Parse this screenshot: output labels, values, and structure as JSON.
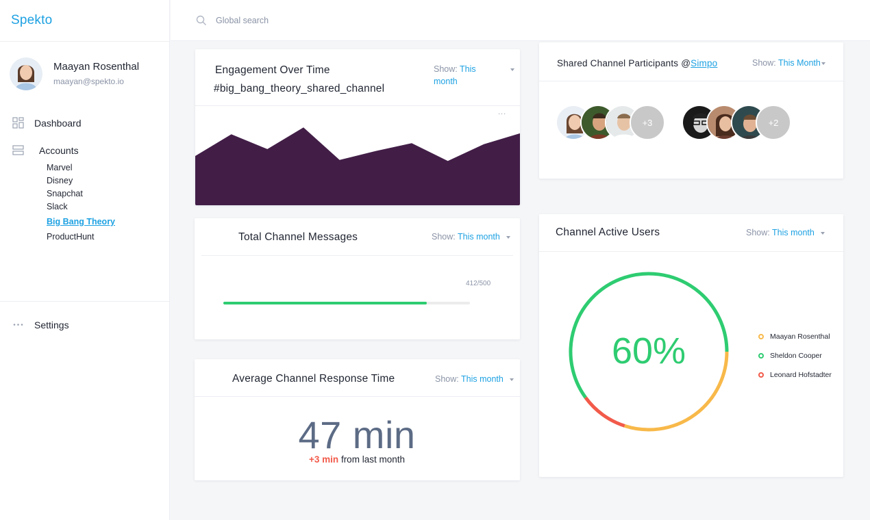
{
  "app": {
    "logo": "Spekto"
  },
  "user": {
    "name": "Maayan Rosenthal",
    "email": "maayan@spekto.io"
  },
  "nav": {
    "dashboard": "Dashboard",
    "accounts": "Accounts",
    "accounts_children": [
      "Marvel",
      "Disney",
      "Snapchat",
      "Slack",
      "Big Bang Theory",
      "ProductHunt"
    ],
    "active_child": "Big Bang Theory",
    "settings": "Settings"
  },
  "search": {
    "placeholder": "Global search"
  },
  "engagement": {
    "title": "Engagement Over Time",
    "subtitle": "#big_bang_theory_shared_channel",
    "show_label": "Show:",
    "show_value": "This month",
    "more": "...",
    "area_color": "#421e47",
    "chart_data": {
      "type": "area",
      "x": [
        1,
        2,
        3,
        4,
        5,
        6,
        7,
        8,
        9,
        10
      ],
      "values": [
        50,
        72,
        57,
        79,
        46,
        55,
        63,
        45,
        62,
        73
      ],
      "ylim": [
        0,
        100
      ],
      "xlabel": "",
      "ylabel": ""
    }
  },
  "messages": {
    "title": "Total Channel Messages",
    "show_label": "Show:",
    "show_value": "This month",
    "current": 412,
    "total": 500,
    "progress_text": "412/500",
    "bar_color": "#2ecc71"
  },
  "response": {
    "title": "Average Channel Response Time",
    "show_label": "Show:",
    "show_value": "This month",
    "value": "47 min",
    "delta": "+3 min",
    "delta_suffix": " from last month"
  },
  "participants": {
    "title_prefix": "Shared Channel Participants @",
    "title_link": "Simpo",
    "show_label": "Show:",
    "show_value": "This Month",
    "group1_more": "+3",
    "group2_more": "+2"
  },
  "active_users": {
    "title": "Channel Active Users",
    "show_label": "Show:",
    "show_value": "This month",
    "percent_text": "60%",
    "chart_data": {
      "type": "pie",
      "categories": [
        "Maayan Rosenthal",
        "Sheldon Cooper",
        "Leonard Hofstadter"
      ],
      "values": [
        30,
        60,
        10
      ],
      "colors": [
        "#f8b94a",
        "#2ecc71",
        "#f25a4a"
      ]
    }
  }
}
